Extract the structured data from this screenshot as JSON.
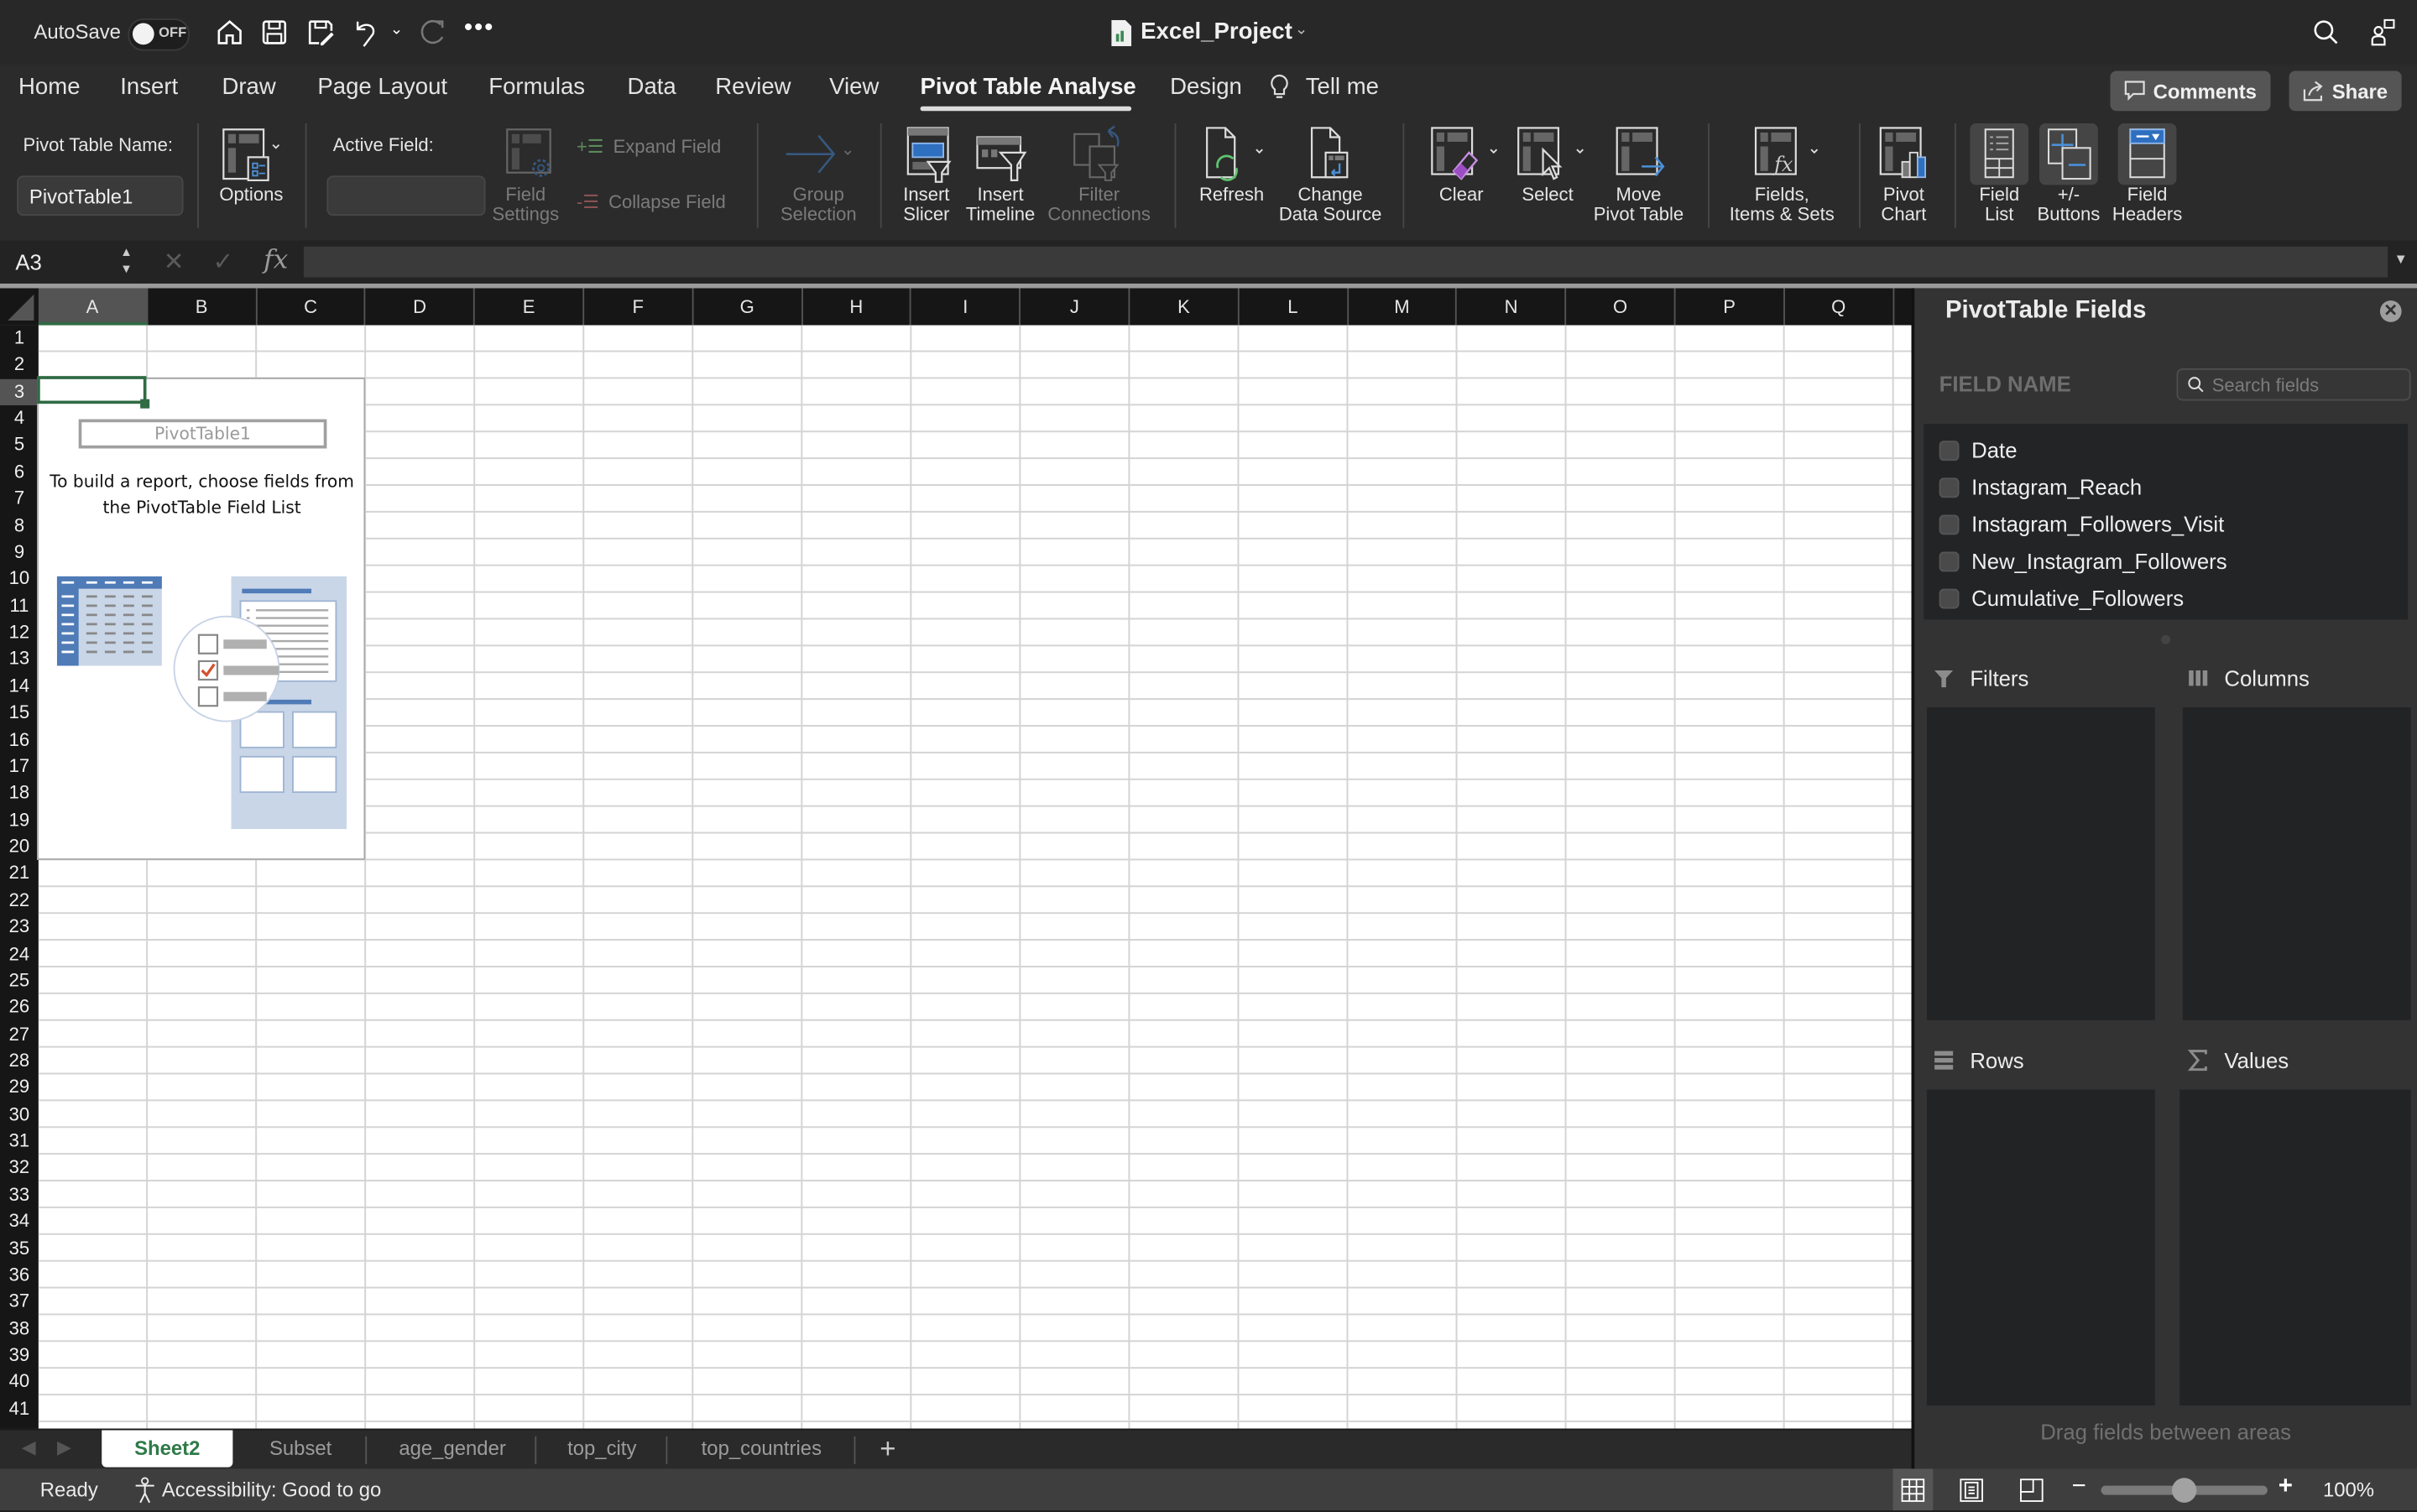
{
  "titlebar": {
    "autosave_label": "AutoSave",
    "autosave_state": "OFF",
    "document_title": "Excel_Project",
    "icons": [
      "home-icon",
      "save-icon",
      "save-as-icon",
      "undo-icon",
      "undo-dropdown-icon",
      "redo-icon",
      "more-icon",
      "search-icon",
      "share-people-icon"
    ]
  },
  "tabs": [
    {
      "label": "Home"
    },
    {
      "label": "Insert"
    },
    {
      "label": "Draw"
    },
    {
      "label": "Page Layout"
    },
    {
      "label": "Formulas"
    },
    {
      "label": "Data"
    },
    {
      "label": "Review"
    },
    {
      "label": "View"
    },
    {
      "label": "Pivot Table Analyse",
      "active": true
    },
    {
      "label": "Design"
    },
    {
      "label": "Tell me"
    }
  ],
  "actions": {
    "comments": "Comments",
    "share": "Share"
  },
  "ribbon": {
    "pivot_table_name_label": "Pivot Table Name:",
    "pivot_table_name_value": "PivotTable1",
    "options": "Options",
    "active_field_label": "Active Field:",
    "active_field_value": "",
    "field_settings": [
      "Field",
      "Settings"
    ],
    "expand_field": "Expand Field",
    "collapse_field": "Collapse Field",
    "group_selection": [
      "Group",
      "Selection"
    ],
    "insert_slicer": [
      "Insert",
      "Slicer"
    ],
    "insert_timeline": [
      "Insert",
      "Timeline"
    ],
    "filter_connections": [
      "Filter",
      "Connections"
    ],
    "refresh": "Refresh",
    "change_data_source": [
      "Change",
      "Data Source"
    ],
    "clear": "Clear",
    "select": "Select",
    "move_pivot_table": [
      "Move",
      "Pivot Table"
    ],
    "fields_items_sets": [
      "Fields,",
      "Items & Sets"
    ],
    "pivot_chart": [
      "Pivot",
      "Chart"
    ],
    "field_list": [
      "Field",
      "List"
    ],
    "plus_minus_buttons": [
      "+/-",
      "Buttons"
    ],
    "field_headers": [
      "Field",
      "Headers"
    ]
  },
  "formula_bar": {
    "name_box": "A3",
    "formula": ""
  },
  "grid": {
    "columns": [
      "A",
      "B",
      "C",
      "D",
      "E",
      "F",
      "G",
      "H",
      "I",
      "J",
      "K",
      "L",
      "M",
      "N",
      "O",
      "P",
      "Q"
    ],
    "rows": [
      "1",
      "2",
      "3",
      "4",
      "5",
      "6",
      "7",
      "8",
      "9",
      "10",
      "11",
      "12",
      "13",
      "14",
      "15",
      "16",
      "17",
      "18",
      "19",
      "20",
      "21",
      "22",
      "23",
      "24",
      "25",
      "26",
      "27",
      "28",
      "29",
      "30",
      "31",
      "32",
      "33",
      "34",
      "35",
      "36",
      "37",
      "38",
      "39",
      "40",
      "41"
    ],
    "selected_column": "A",
    "selected_row": "3"
  },
  "pivot_placeholder": {
    "name": "PivotTable1",
    "instructions": "To build a report, choose fields from the PivotTable Field List"
  },
  "sheet_tabs": [
    {
      "label": "Sheet2",
      "active": true
    },
    {
      "label": "Subset"
    },
    {
      "label": "age_gender"
    },
    {
      "label": "top_city"
    },
    {
      "label": "top_countries"
    }
  ],
  "status": {
    "ready": "Ready",
    "accessibility": "Accessibility: Good to go",
    "zoom": "100%",
    "zoom_fraction": 0.5
  },
  "panel": {
    "title": "PivotTable Fields",
    "field_name_header": "FIELD NAME",
    "search_placeholder": "Search fields",
    "fields": [
      {
        "label": "Date",
        "checked": false
      },
      {
        "label": "Instagram_Reach",
        "checked": false
      },
      {
        "label": "Instagram_Followers_Visit",
        "checked": false
      },
      {
        "label": "New_Instagram_Followers",
        "checked": false
      },
      {
        "label": "Cumulative_Followers",
        "checked": false
      }
    ],
    "areas": {
      "filters": "Filters",
      "columns": "Columns",
      "rows": "Rows",
      "values": "Values"
    },
    "drag_hint": "Drag fields between areas"
  },
  "colors": {
    "accent_green": "#2f6b43",
    "sheet_tab_green": "#2f7a49",
    "ribbon_bg": "#2b2b2b",
    "illustration_blue": "#4f7bb7"
  }
}
